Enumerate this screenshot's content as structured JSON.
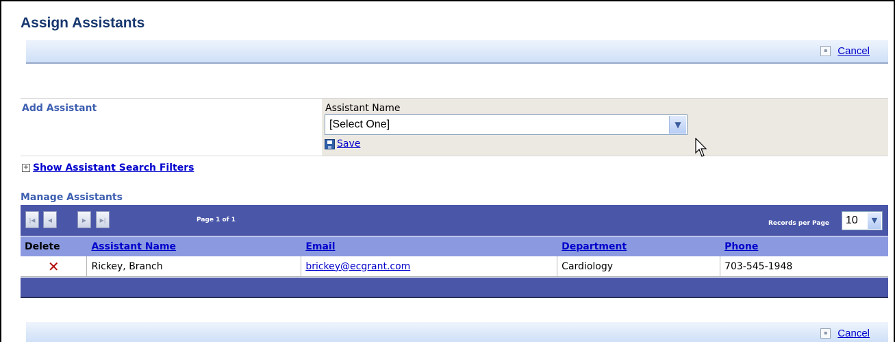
{
  "page": {
    "title": "Assign Assistants"
  },
  "commands": {
    "cancel_label": "Cancel"
  },
  "add_assistant": {
    "section_label": "Add Assistant",
    "field_label": "Assistant Name",
    "select_value": "[Select One]",
    "save_label": "Save"
  },
  "filters": {
    "toggle_label": "Show Assistant Search Filters"
  },
  "manage": {
    "section_label": "Manage Assistants",
    "pager": {
      "page_info": "Page 1 of 1",
      "records_per_page_label": "Records per Page",
      "records_per_page_value": "10"
    },
    "columns": {
      "delete": "Delete",
      "name": "Assistant Name",
      "email": "Email",
      "department": "Department",
      "phone": "Phone"
    },
    "rows": [
      {
        "name": "Rickey, Branch",
        "email": "brickey@ecgrant.com",
        "department": "Cardiology",
        "phone": "703-545-1948"
      }
    ]
  },
  "icons": {
    "cancel": "cancel-icon",
    "save": "floppy-disk-icon",
    "expand": "plus-box-icon",
    "delete": "red-x-icon",
    "pager": [
      "first-page-icon",
      "prev-page-icon",
      "next-page-icon",
      "last-page-icon"
    ]
  },
  "colors": {
    "title": "#17376e",
    "section_label": "#3d5fb0",
    "pager_bar": "#4a56a8",
    "grid_header": "#8b9ae0",
    "delete_x": "#b00000",
    "add_panel": "#ece9e2"
  }
}
